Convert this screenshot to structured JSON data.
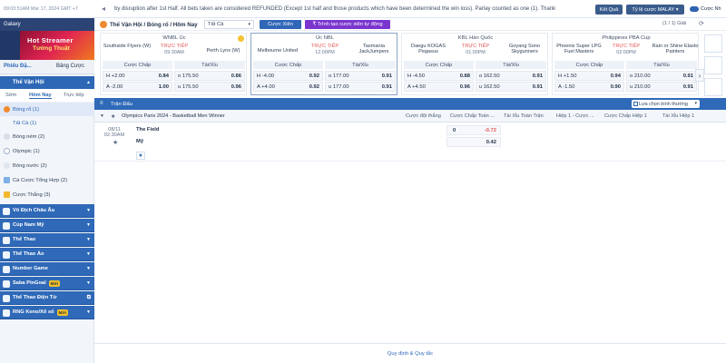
{
  "topbar": {
    "time": "09:03:51AM Mar 17, 2024 GMT +7",
    "ticker": "by disruption after 1st Half. All bets taken are considered REFUNDED (Except 1st half and those products which have been determined the win loss). Parlay counted as one (1). Thank",
    "results_label": "Kết Quả",
    "odds_label": "Tỷ lệ cược MALAY",
    "toggle_label": "Cược Nh"
  },
  "sidebar": {
    "galaxy_label": "Galaxy",
    "promo_title": "Hot Streamer",
    "promo_sub": "Tường Thuật",
    "tabs": [
      "Phiếu Đặ...",
      "Bảng Cược"
    ],
    "periods": [
      "Sớm",
      "Hôm Nay",
      "Trực tiếp"
    ],
    "section_title": "Thể Vận Hội",
    "items": [
      {
        "label": "Bóng rổ (1)"
      },
      {
        "label": "Tất Cả (1)"
      },
      {
        "label": "Bóng ném (2)"
      },
      {
        "label": "Olympic (1)"
      },
      {
        "label": "Bóng nước (2)"
      },
      {
        "label": "Cá Cược Tổng Hợp (2)"
      },
      {
        "label": "Cược Thắng (3)"
      }
    ],
    "menus": [
      {
        "label": "Vô Địch Châu Âu",
        "badge": ""
      },
      {
        "label": "Cúp Nam Mỹ",
        "badge": ""
      },
      {
        "label": "Thể Thao",
        "badge": ""
      },
      {
        "label": "Thể Thao Ảo",
        "badge": ""
      },
      {
        "label": "Number Game",
        "badge": ""
      },
      {
        "label": "Saba PinGoal",
        "badge": "Mới"
      },
      {
        "label": "Thể Thao Điện Tử",
        "badge": ""
      },
      {
        "label": "RNG Keno/Xổ số",
        "badge": "Mới"
      }
    ]
  },
  "main": {
    "breadcrumb": "Thể Vận Hội / Bóng rổ / Hôm Nay",
    "select_value": "Tất Cả",
    "btn_parlay": "Cược Xiên",
    "btn_create": "₹ Trình tạo cược xiên tự động",
    "pager": "(1 / 1) Giải",
    "odds_headers": [
      "Cược Chấp",
      "Tài/Xỉu"
    ],
    "cards": [
      {
        "league": "WNBL Úc",
        "home": "Southside Flyers (W)",
        "away": "Perth Lynx (W)",
        "live": "TRỰC TIẾP",
        "time": "09:30AM",
        "h": [
          "H +2.00",
          "0.84",
          "o 175.50",
          "0.86"
        ],
        "a": [
          "A -2.00",
          "1.00",
          "u 175.50",
          "0.96"
        ]
      },
      {
        "league": "Úc NBL",
        "home": "Melbourne United",
        "away": "Tasmania JackJumpers",
        "live": "TRỰC TIẾP",
        "time": "12:00PM",
        "h": [
          "H -4.00",
          "0.92",
          "o 177.00",
          "0.91"
        ],
        "a": [
          "A +4.00",
          "0.92",
          "u 177.00",
          "0.91"
        ]
      },
      {
        "league": "KBL Hàn Quốc",
        "home": "Daegu KOGAS Pegasus",
        "away": "Goyang Sono Skygunners",
        "live": "TRỰC TIẾP",
        "time": "01:00PM",
        "h": [
          "H -4.50",
          "0.88",
          "o 162.50",
          "0.91"
        ],
        "a": [
          "A +4.50",
          "0.96",
          "u 162.50",
          "0.91"
        ]
      },
      {
        "league": "Philippines PBA Cup",
        "home": "Phoenix Super LPG Fuel Masters",
        "away": "Rain or Shine Elasto Painters",
        "live": "TRỰC TIẾP",
        "time": "02:00PM",
        "h": [
          "H +1.50",
          "0.94",
          "o 210.00",
          "0.91"
        ],
        "a": [
          "A -1.50",
          "0.90",
          "u 210.00",
          "0.91"
        ]
      }
    ],
    "games_tab": "Trận Đấu",
    "sort_label": "Lựa chọn bình thường",
    "columns": [
      "Olympics Paris 2024 - Basketball Men Winner",
      "Cược đội thắng",
      "Cược Chấp Toàn ...",
      "Tài Xỉu Toàn Trận",
      "Hiệp 1 - Cược ...",
      "Cược Chấp Hiệp 1",
      "Tài Xỉu Hiệp 1"
    ],
    "match": {
      "date": "08/11",
      "time": "02:30AM",
      "home": "The Field",
      "away": "Mỹ",
      "line_zero": "0",
      "odd_home": "-0.72",
      "odd_away": "0.42"
    },
    "footer": "Quy định & Quy tắc"
  },
  "colors": {
    "primary": "#2f6ab8",
    "live": "#e65757",
    "purple": "#7b35cf"
  }
}
